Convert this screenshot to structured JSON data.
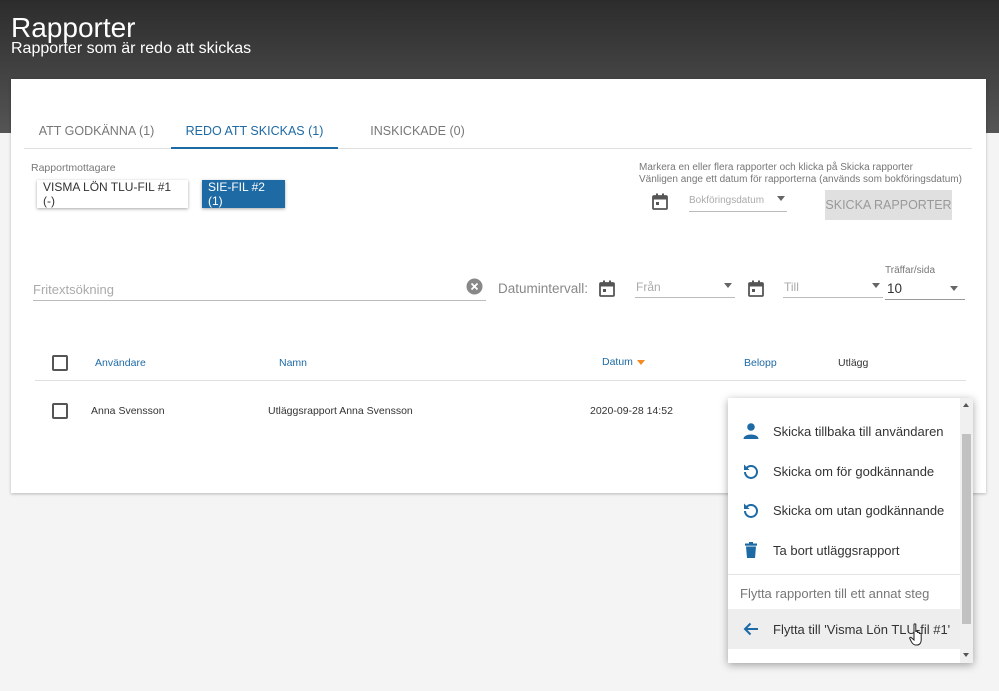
{
  "header": {
    "title": "Rapporter",
    "subtitle": "Rapporter som är redo att skickas"
  },
  "tabs": [
    {
      "label": "ATT GODKÄNNA (1)",
      "active": false
    },
    {
      "label": "REDO ATT SKICKAS (1)",
      "active": true
    },
    {
      "label": "INSKICKADE (0)",
      "active": false
    }
  ],
  "recipients": {
    "label": "Rapportmottagare",
    "chips": [
      {
        "label": "VISMA LÖN TLU-FIL #1 (-)"
      },
      {
        "label": "SIE-FIL #2 (1)"
      }
    ]
  },
  "send": {
    "hint_line1": "Markera en eller flera rapporter och klicka på Skicka rapporter",
    "hint_line2": "Vänligen ange ett datum för rapporterna (används som bokföringsdatum)",
    "date_placeholder": "Bokföringsdatum",
    "button_label": "SKICKA RAPPORTER"
  },
  "filters": {
    "search_placeholder": "Fritextsökning",
    "date_range_label": "Datumintervall:",
    "from_placeholder": "Från",
    "to_placeholder": "Till",
    "per_page_label": "Träffar/sida",
    "per_page_value": "10"
  },
  "table": {
    "columns": [
      "Användare",
      "Namn",
      "Datum",
      "Belopp",
      "Utlägg"
    ],
    "rows": [
      {
        "user": "Anna Svensson",
        "name": "Utläggsrapport Anna Svensson",
        "date": "2020-09-28 14:52"
      }
    ]
  },
  "context_menu": {
    "items": [
      {
        "label": "Skicka tillbaka till användaren",
        "icon": "person-icon"
      },
      {
        "label": "Skicka om för godkännande",
        "icon": "refresh-icon"
      },
      {
        "label": "Skicka om utan godkännande",
        "icon": "refresh-icon"
      },
      {
        "label": "Ta bort utläggsrapport",
        "icon": "trash-icon"
      }
    ],
    "section_label": "Flytta rapporten till ett annat steg",
    "move_item": {
      "label": "Flytta till 'Visma Lön TLU-fil #1'",
      "icon": "arrow-left-icon"
    }
  },
  "colors": {
    "accent": "#1d6aa5",
    "sort_arrow": "#f28a1e"
  }
}
